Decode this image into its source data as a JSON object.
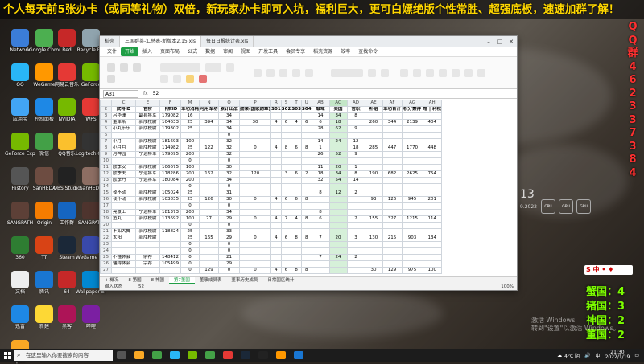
{
  "banner": "个人每天前5张办卡（或同等礼物）双倍，新玩家办卡即可入坑，福利巨大，更可白嫖绝版个性常胜、超强底板，速速加群了解！",
  "qq_column": [
    "Q",
    "Q",
    "群",
    "4",
    "6",
    "2",
    "3",
    "3",
    "7",
    "3",
    "8",
    "4"
  ],
  "score": [
    {
      "label": "蟹国：4"
    },
    {
      "label": "猪国：3"
    },
    {
      "label": "神国：2"
    },
    {
      "label": "董国：2"
    }
  ],
  "activate_line1": "激活 Windows",
  "activate_line2": "转到\"设置\"以激活 Windows。",
  "ime_label": "S 中 • ♦",
  "desktop_icons": [
    {
      "label": "Network",
      "color": "#3b7dd8"
    },
    {
      "label": "Google Chrome",
      "color": "#4caf50"
    },
    {
      "label": "Red",
      "color": "#c62828"
    },
    {
      "label": "Recycle Bin",
      "color": "#90a4ae"
    },
    {
      "label": "QQ",
      "color": "#29b6f6"
    },
    {
      "label": "WeGame",
      "color": "#ff9800"
    },
    {
      "label": "网易云音乐",
      "color": "#e53935"
    },
    {
      "label": "GeForce",
      "color": "#76b900"
    },
    {
      "label": "应用宝",
      "color": "#42a5f5"
    },
    {
      "label": "控制面板",
      "color": "#1e88e5"
    },
    {
      "label": "NVIDIA",
      "color": "#76b900"
    },
    {
      "label": "WPS",
      "color": "#e53935"
    },
    {
      "label": "GeForce Experience",
      "color": "#76b900"
    },
    {
      "label": "微信",
      "color": "#43a047"
    },
    {
      "label": "QQ音乐",
      "color": "#fbc02d"
    },
    {
      "label": "Logitech G HUB",
      "color": "#333333"
    },
    {
      "label": "History",
      "color": "#555555"
    },
    {
      "label": "SanHEDA",
      "color": "#6d4c41"
    },
    {
      "label": "OBS Studio",
      "color": "#222222"
    },
    {
      "label": "SanHEDA",
      "color": "#8d6e63"
    },
    {
      "label": "SANGPATH",
      "color": "#5d4037"
    },
    {
      "label": "Origin",
      "color": "#f57c00"
    },
    {
      "label": "工作群",
      "color": "#1565c0"
    },
    {
      "label": "SANGPATH",
      "color": "#4e342e"
    },
    {
      "label": "360",
      "color": "#2e7d32"
    },
    {
      "label": "TT",
      "color": "#d84315"
    },
    {
      "label": "Steam",
      "color": "#1b2838"
    },
    {
      "label": "WeGame Engine",
      "color": "#3949ab"
    },
    {
      "label": "文档",
      "color": "#eeeeee"
    },
    {
      "label": "腾讯",
      "color": "#1976d2"
    },
    {
      "label": "64",
      "color": "#c62828"
    },
    {
      "label": "Wallpaper Engine",
      "color": "#0288d1"
    },
    {
      "label": "迅雷",
      "color": "#1e88e5"
    },
    {
      "label": "新建",
      "color": "#fdd835"
    },
    {
      "label": "黑客",
      "color": "#ad1457"
    },
    {
      "label": "哔哩",
      "color": "#7b1fa2"
    },
    {
      "label": "ipad",
      "color": "#f9a825"
    }
  ],
  "clock_widget": {
    "time": "13",
    "date": "9.2022",
    "labels": [
      "CPU",
      "GPU",
      "GPU"
    ]
  },
  "excel": {
    "window_tabs": [
      "稻壳",
      "三国群英-汇总表-新版本2.15.xls",
      "每日日报统计表.xls"
    ],
    "menus": [
      "文件",
      "开始",
      "插入",
      "页面布局",
      "公式",
      "数据",
      "审阅",
      "视图",
      "开发工具",
      "会员专享",
      "稻壳资源",
      "效率",
      "查找命令"
    ],
    "active_menu": "开始",
    "name_box": "A31",
    "formula_value": "52",
    "col_headers": [
      "",
      "C",
      "E",
      "F",
      "M",
      "N",
      "O",
      "P",
      "R",
      "S",
      "T",
      "U",
      "AB",
      "AC",
      "AD",
      "AE",
      "AF",
      "AG",
      "AH"
    ],
    "header_row": [
      "武将ID",
      "官阶",
      "卡牌ID",
      "军功消耗",
      "可用军功",
      "累计出战",
      "勋荣(国家勋章)",
      "S01",
      "S02",
      "S03",
      "S04",
      "城域",
      "关国",
      "官职",
      "补给",
      "军功合计",
      "积分兼得",
      "增 | 利积"
    ],
    "rows": [
      [
        "3",
        "吕华珊",
        "副县将军",
        "179082",
        "16",
        "",
        "34",
        "",
        "",
        "",
        "",
        "",
        "14",
        "34",
        "8",
        "",
        "",
        "",
        ""
      ],
      [
        "4",
        "董卓斯",
        "驿戍校尉",
        "104633",
        "25",
        "394",
        "34",
        "30",
        "4",
        "6",
        "4",
        "6",
        "6",
        "18",
        "",
        "260",
        "344",
        "2139",
        "404"
      ],
      [
        "5",
        "小丸乐乐",
        "驿戍校尉",
        "179302",
        "25",
        "",
        "34",
        "",
        "",
        "",
        "",
        "",
        "28",
        "62",
        "9",
        "",
        "",
        "",
        ""
      ],
      [
        "6",
        "",
        "",
        "",
        "",
        "",
        "0",
        "",
        "",
        "",
        "",
        "",
        "",
        "",
        "",
        "",
        "",
        "",
        ""
      ],
      [
        "7",
        "小月",
        "驿戍校尉",
        "181693",
        "100",
        "",
        "32",
        "",
        "",
        "",
        "",
        "",
        "14",
        "24",
        "12",
        "",
        "",
        "",
        ""
      ],
      [
        "8",
        "小月月",
        "驿戍校尉",
        "114982",
        "25",
        "122",
        "32",
        "0",
        "4",
        "8",
        "6",
        "8",
        "1",
        "",
        "18",
        "285",
        "447",
        "1770",
        "448"
      ],
      [
        "9",
        "月神园",
        "宁远将军",
        "179095",
        "200",
        "",
        "32",
        "",
        "",
        "",
        "",
        "",
        "26",
        "52",
        "9",
        "",
        "",
        "",
        ""
      ],
      [
        "10",
        "",
        "",
        "",
        "0",
        "",
        "0",
        "",
        "",
        "",
        "",
        "",
        "",
        "",
        "",
        "",
        "",
        "",
        ""
      ],
      [
        "11",
        "欧季安",
        "驿戍校尉",
        "106675",
        "100",
        "",
        "30",
        "",
        "",
        "",
        "",
        "",
        "11",
        "20",
        "1",
        "",
        "",
        "",
        ""
      ],
      [
        "12",
        "欧季夫",
        "宁远将军",
        "178286",
        "200",
        "162",
        "32",
        "120",
        "",
        "3",
        "6",
        "2",
        "18",
        "34",
        "8",
        "190",
        "682",
        "2625",
        "754"
      ],
      [
        "13",
        "欧季丹",
        "宁远将军",
        "180084",
        "200",
        "",
        "34",
        "",
        "",
        "",
        "",
        "",
        "32",
        "54",
        "14",
        "",
        "",
        "",
        ""
      ],
      [
        "14",
        "",
        "",
        "",
        "0",
        "",
        "0",
        "",
        "",
        "",
        "",
        "",
        "",
        "",
        "",
        "",
        "",
        "",
        ""
      ],
      [
        "15",
        "夜不动",
        "驿戍校尉",
        "105024",
        "25",
        "",
        "31",
        "",
        "",
        "",
        "",
        "",
        "8",
        "12",
        "2",
        "",
        "",
        "",
        ""
      ],
      [
        "16",
        "夜不动",
        "驿戍校尉",
        "103835",
        "25",
        "126",
        "30",
        "0",
        "4",
        "6",
        "6",
        "8",
        "",
        "",
        "",
        "93",
        "126",
        "945",
        "201"
      ],
      [
        "17",
        "",
        "",
        "",
        "0",
        "",
        "0",
        "",
        "",
        "",
        "",
        "",
        "",
        "",
        "",
        "",
        "",
        "",
        ""
      ],
      [
        "18",
        "亮景上",
        "宁远将军",
        "181373",
        "200",
        "",
        "34",
        "",
        "",
        "",
        "",
        "",
        "8",
        "",
        "",
        "",
        "",
        "",
        ""
      ],
      [
        "19",
        "鱼丸",
        "驿戍校尉",
        "113692",
        "100",
        "27",
        "29",
        "0",
        "4",
        "7",
        "4",
        "8",
        "6",
        "",
        "2",
        "155",
        "327",
        "1215",
        "114"
      ],
      [
        "20",
        "",
        "",
        "",
        "0",
        "",
        "0",
        "",
        "",
        "",
        "",
        "",
        "",
        "",
        "",
        "",
        "",
        "",
        ""
      ],
      [
        "21",
        "不如大舞",
        "驿戍校尉",
        "118824",
        "25",
        "",
        "33",
        "",
        "",
        "",
        "",
        "",
        "",
        "",
        "",
        "",
        "",
        "",
        ""
      ],
      [
        "22",
        "太阳",
        "驿戍校尉",
        "",
        "25",
        "165",
        "29",
        "0",
        "4",
        "6",
        "8",
        "8",
        "7",
        "20",
        "3",
        "130",
        "215",
        "903",
        "134"
      ],
      [
        "23",
        "",
        "",
        "",
        "0",
        "",
        "0",
        "",
        "",
        "",
        "",
        "",
        "",
        "",
        "",
        "",
        "",
        "",
        ""
      ],
      [
        "24",
        "",
        "",
        "",
        "0",
        "",
        "0",
        "",
        "",
        "",
        "",
        "",
        "",
        "",
        "",
        "",
        "",
        "",
        ""
      ],
      [
        "25",
        "不懂休会",
        "宗荐",
        "148412",
        "0",
        "",
        "21",
        "",
        "",
        "",
        "",
        "",
        "7",
        "24",
        "2",
        "",
        "",
        "",
        ""
      ],
      [
        "26",
        "懂得休会",
        "宗荐",
        "105499",
        "0",
        "",
        "29",
        "",
        "",
        "",
        "",
        "",
        "",
        "",
        "",
        "",
        "",
        "",
        ""
      ],
      [
        "27",
        "",
        "",
        "",
        "0",
        "129",
        "0",
        "0",
        "4",
        "6",
        "8",
        "8",
        "",
        "",
        "",
        "30",
        "129",
        "975",
        "100"
      ]
    ],
    "sheet_tabs": [
      "+ 概况",
      "8 第国",
      "8 神国",
      "第7董国",
      "董事成员表",
      "董事历史成员",
      "日常国区统计"
    ],
    "active_sheet": "第7董国",
    "status_left": "输入状态",
    "status_value": "52",
    "zoom": "100%"
  },
  "taskbar": {
    "search_placeholder": "在这里输入你要搜索的内容",
    "temperature": "4°C 阴",
    "time": "21:30",
    "date": "2022/1/19",
    "lang": "中"
  }
}
